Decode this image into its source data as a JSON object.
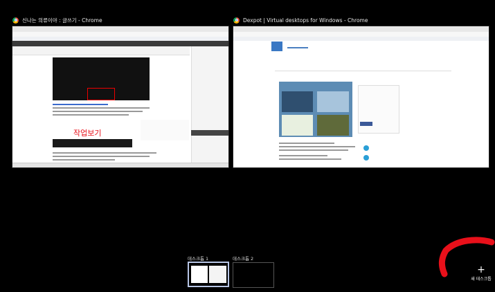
{
  "windows": [
    {
      "title": "신나는 의류이야 : 글쓰기 - Chrome",
      "icon": "chrome-icon",
      "overlay_text": "작업보기"
    },
    {
      "title": "Dexpot | Virtual desktops for Windows - Chrome",
      "icon": "chrome-icon"
    }
  ],
  "desktops": [
    {
      "label": "데스크톱 1",
      "selected": true
    },
    {
      "label": "데스크톱 2",
      "selected": false
    }
  ],
  "new_desktop": {
    "icon": "plus-icon",
    "symbol": "+",
    "label": "새 데스크톱"
  },
  "colors": {
    "background": "#000000",
    "annotation": "#e8101a",
    "selected_border": "#b8c6e6"
  }
}
